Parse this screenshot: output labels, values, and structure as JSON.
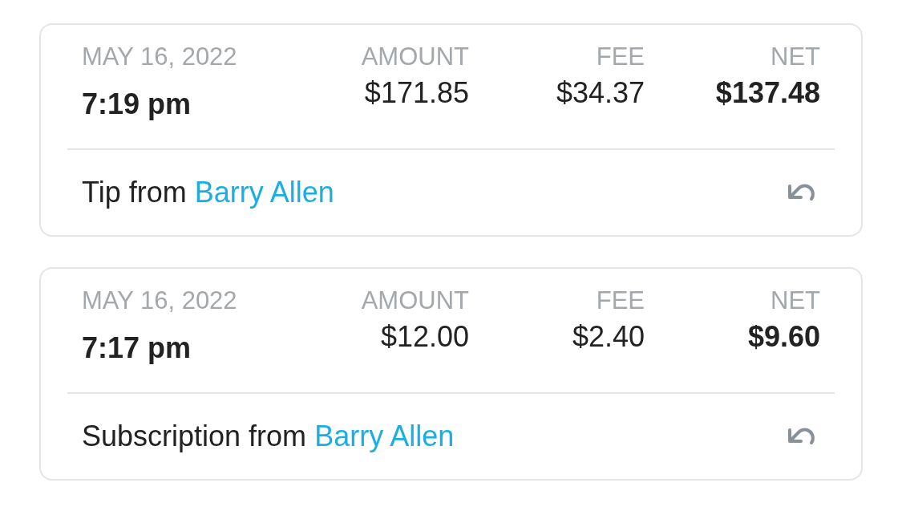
{
  "transactions": [
    {
      "date": "MAY 16, 2022",
      "time": "7:19 pm",
      "columns": [
        {
          "label": "AMOUNT",
          "value": "$171.85",
          "bold": false
        },
        {
          "label": "FEE",
          "value": "$34.37",
          "bold": false
        },
        {
          "label": "NET",
          "value": "$137.48",
          "bold": true
        }
      ],
      "description": "Tip from",
      "sender": "Barry Allen"
    },
    {
      "date": "MAY 16, 2022",
      "time": "7:17 pm",
      "columns": [
        {
          "label": "AMOUNT",
          "value": "$12.00",
          "bold": false
        },
        {
          "label": "FEE",
          "value": "$2.40",
          "bold": false
        },
        {
          "label": "NET",
          "value": "$9.60",
          "bold": true
        }
      ],
      "description": "Subscription from",
      "sender": "Barry Allen"
    }
  ]
}
